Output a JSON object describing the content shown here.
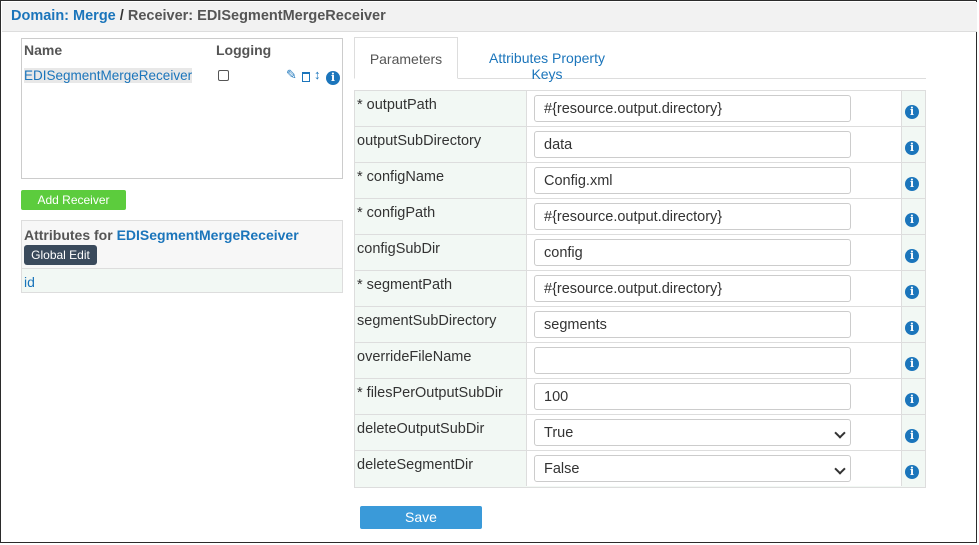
{
  "header": {
    "domain_label": "Domain: Merge",
    "separator": " / ",
    "receiver_label": "Receiver: EDISegmentMergeReceiver"
  },
  "receivers": {
    "col_name": "Name",
    "col_logging": "Logging",
    "rows": [
      {
        "name": "EDISegmentMergeReceiver",
        "logging": false
      }
    ]
  },
  "add_receiver_label": "Add Receiver",
  "attributes": {
    "title_prefix": "Attributes for ",
    "receiver_name": "EDISegmentMergeReceiver",
    "global_edit_label": "Global Edit",
    "items": [
      "id"
    ]
  },
  "tabs": {
    "parameters": "Parameters",
    "property_keys": "Attributes Property Keys"
  },
  "params": [
    {
      "label": "* outputPath",
      "value": "#{resource.output.directory}",
      "type": "text"
    },
    {
      "label": "outputSubDirectory",
      "value": "data",
      "type": "text"
    },
    {
      "label": "* configName",
      "value": "Config.xml",
      "type": "text"
    },
    {
      "label": "* configPath",
      "value": "#{resource.output.directory}",
      "type": "text"
    },
    {
      "label": "configSubDir",
      "value": "config",
      "type": "text"
    },
    {
      "label": "* segmentPath",
      "value": "#{resource.output.directory}",
      "type": "text"
    },
    {
      "label": "segmentSubDirectory",
      "value": "segments",
      "type": "text"
    },
    {
      "label": "overrideFileName",
      "value": "",
      "type": "text"
    },
    {
      "label": "* filesPerOutputSubDir",
      "value": "100",
      "type": "text"
    },
    {
      "label": "deleteOutputSubDir",
      "value": "True",
      "type": "select"
    },
    {
      "label": "deleteSegmentDir",
      "value": "False",
      "type": "select"
    }
  ],
  "save_label": "Save",
  "colors": {
    "link": "#1b75bb",
    "add_button": "#5ccc3d",
    "save_button": "#3a9ad9",
    "global_edit_button": "#3a4a5c"
  }
}
